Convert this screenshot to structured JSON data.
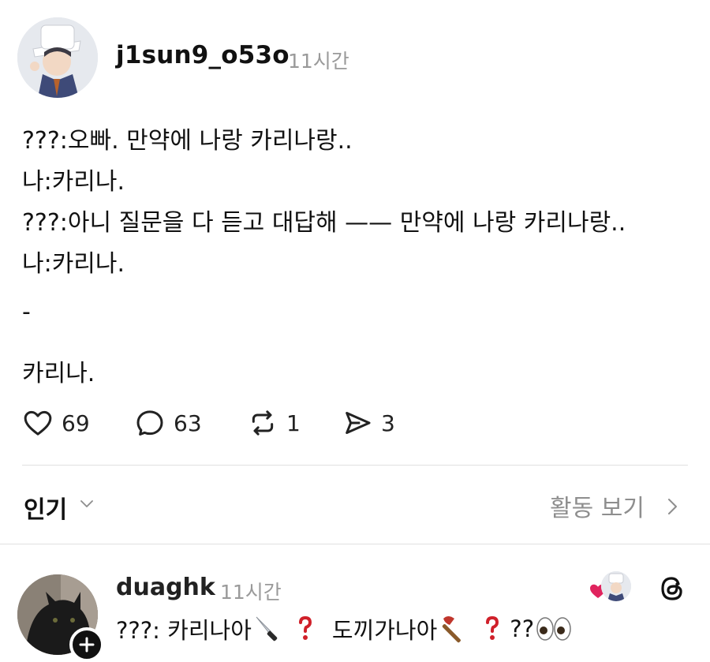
{
  "post": {
    "username": "j1sun9_o53o",
    "time": "11시간",
    "lines": [
      "???:오빠. 만약에 나랑 카리나랑..",
      "나:카리나.",
      "???:아니 질문을 다 듣고 대답해 —— 만약에 나랑 카리나랑..",
      "나:카리나.",
      "-",
      "카리나."
    ],
    "actions": {
      "like_count": "69",
      "comment_count": "63",
      "repost_count": "1",
      "share_count": "3"
    }
  },
  "sort_bar": {
    "label": "인기",
    "activity_label": "활동 보기"
  },
  "reply": {
    "username": "duaghk",
    "time": "11시간",
    "text_part1": "???: 카리나아",
    "text_part2": "도끼가나아",
    "text_part3": "??",
    "icons": [
      "knife-emoji",
      "red-question-emoji",
      "axe-emoji",
      "eyes-emoji"
    ]
  },
  "colors": {
    "muted": "#9a9a9a",
    "divider": "#e0e0e0",
    "heart": "#e0245e"
  }
}
